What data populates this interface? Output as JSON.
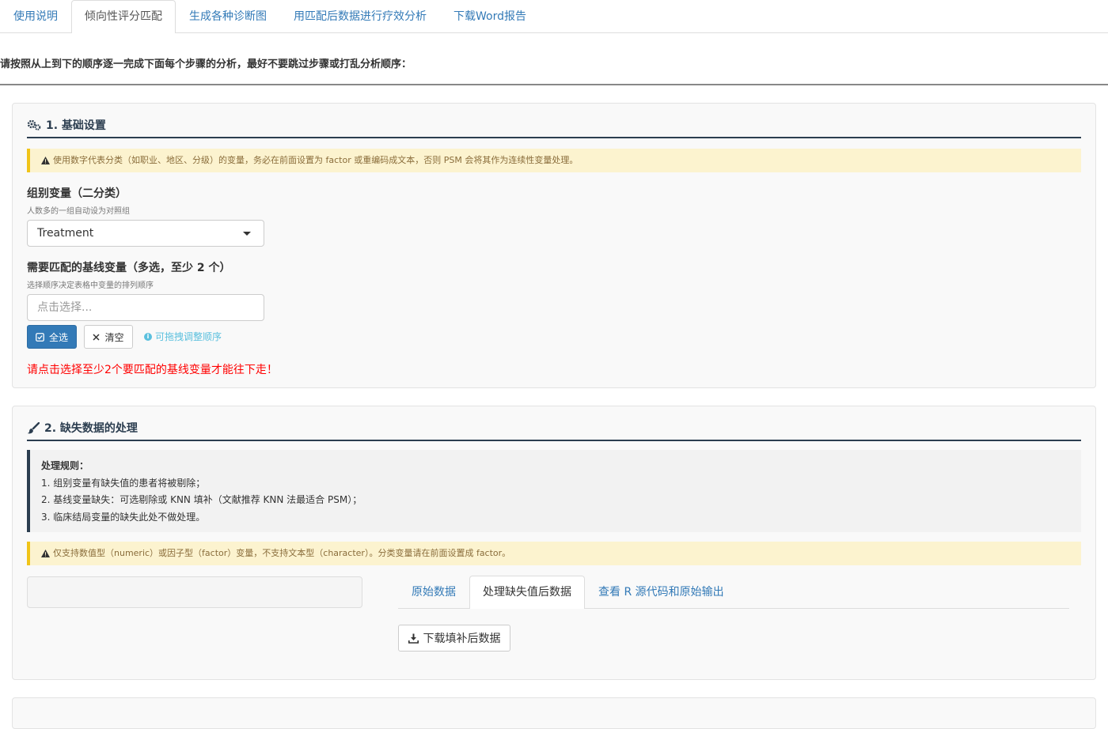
{
  "top_tabs": [
    "使用说明",
    "倾向性评分匹配",
    "生成各种诊断图",
    "用匹配后数据进行疗效分析",
    "下载Word报告"
  ],
  "instruction": "请按照从上到下的顺序逐一完成下面每个步骤的分析，最好不要跳过步骤或打乱分析顺序：",
  "section1": {
    "title": "1. 基础设置",
    "icon": "gears-icon",
    "warning": "使用数字代表分类（如职业、地区、分级）的变量，务必在前面设置为 factor 或重编码成文本，否则 PSM 会将其作为连续性变量处理。",
    "group_label": "组别变量（二分类）",
    "group_helper": "人数多的一组自动设为对照组",
    "group_value": "Treatment",
    "baseline_label": "需要匹配的基线变量（多选，至少 2 个）",
    "baseline_helper": "选择顺序决定表格中变量的排列顺序",
    "baseline_placeholder": "点击选择...",
    "select_all": "全选",
    "clear": "清空",
    "drag_hint": "可拖拽调整顺序",
    "error": "请点击选择至少2个要匹配的基线变量才能往下走！"
  },
  "section2": {
    "title": "2. 缺失数据的处理",
    "icon": "brush-icon",
    "rules_title": "处理规则：",
    "rules": [
      "1. 组别变量有缺失值的患者将被剔除；",
      "2. 基线变量缺失：可选剔除或 KNN 填补（文献推荐 KNN 法最适合 PSM）；",
      "3. 临床结局变量的缺失此处不做处理。"
    ],
    "warning": "仅支持数值型（numeric）或因子型（factor）变量，不支持文本型（character）。分类变量请在前面设置成 factor。",
    "tabs": [
      "原始数据",
      "处理缺失值后数据",
      "查看 R 源代码和原始输出"
    ],
    "active_tab": 1,
    "download": "下载填补后数据"
  },
  "colors": {
    "link": "#337ab7",
    "primary": "#337ab7",
    "warning_bg": "#fcf3cf",
    "warning_border": "#f0c419",
    "error": "#ff0000",
    "title": "#2c3e50"
  }
}
